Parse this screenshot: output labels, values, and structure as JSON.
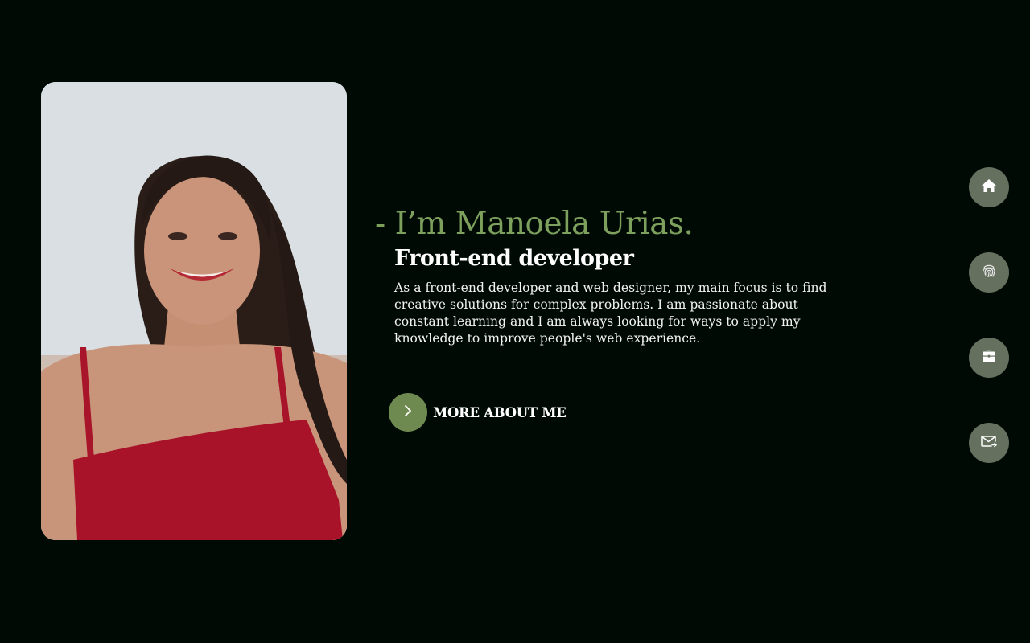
{
  "hero": {
    "title": "- I’m Manoela Urias.",
    "subtitle": "Front-end developer",
    "description": "As a front-end developer and web designer, my main focus is to find creative solutions for complex problems. I am passionate about constant learning and I am always looking for ways to apply my knowledge to improve people's web experience."
  },
  "cta": {
    "label": "MORE ABOUT ME",
    "icon": "chevron-right-icon"
  },
  "nav": {
    "items": [
      {
        "icon": "home-icon"
      },
      {
        "icon": "fingerprint-icon"
      },
      {
        "icon": "briefcase-icon"
      },
      {
        "icon": "mail-icon"
      }
    ]
  },
  "colors": {
    "background": "#000a05",
    "accent": "#7ea05d",
    "button": "#6f8a50",
    "nav_button": "#65705f"
  }
}
